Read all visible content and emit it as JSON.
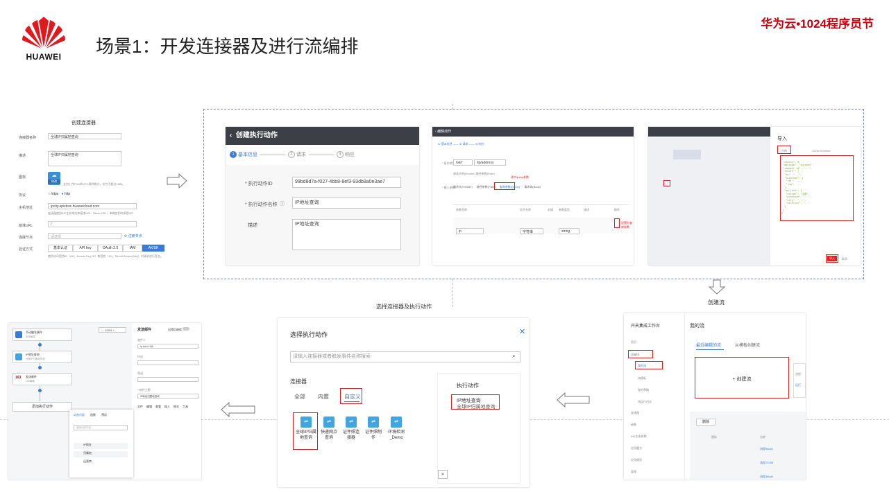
{
  "header": {
    "brand_logo_text": "HUAWEI",
    "title": "场景1：开发连接器及进行流编排",
    "event": "华为云•1024程序员节"
  },
  "connector_form": {
    "title": "创建连接器",
    "fields": [
      {
        "label": "连接器名称",
        "value": "全球IP归属地查询"
      },
      {
        "label": "描述",
        "value": "全球IP归属地查询"
      },
      {
        "label": "图标",
        "value": "修改"
      },
      {
        "label": "协议",
        "value": "https"
      },
      {
        "label": "主机地址",
        "value": "ipcity.apistore.huaweicloud.com"
      },
      {
        "label": "基准URL",
        "value": "/"
      },
      {
        "label": "连接节点",
        "value": "请选择"
      },
      {
        "label": "验证方式",
        "value": ""
      }
    ],
    "protocol_options": [
      "https",
      "http"
    ],
    "auth_tabs": [
      "基本认证",
      "API key",
      "OAuth 2.0",
      "IAM",
      "AK/SK"
    ],
    "auth_active": "AK/SK"
  },
  "action_panel": {
    "header": "创建执行动作",
    "steps": [
      "基本信息",
      "请求",
      "响应"
    ],
    "fields": [
      {
        "label": "* 执行动作ID",
        "value": "99bd8d7a-f027-4bb8-8ef3-93db8a0e3ae7"
      },
      {
        "label": "* 执行动作名称",
        "value": "IP地址查询"
      },
      {
        "label": "描述",
        "value": "IP地址查询"
      }
    ]
  },
  "request_panel": {
    "header": "编辑动作",
    "method": "GET",
    "path": "/ip/address",
    "tabs": [
      "请求头(Header)",
      "路径参数(Path)",
      "查询参数(Query)",
      "请求体(Body)"
    ],
    "note": "选中query参数",
    "red_label": "设置为查询参数",
    "row_value": "ip",
    "type_value": "字符串"
  },
  "import_panel": {
    "title": "导入",
    "tabs": [
      "示例",
      "JSON Schema"
    ],
    "button": "导入",
    "confirm": "确定",
    "cancel": "取消"
  },
  "create_flow_label": "创建流",
  "select_action_label": "选择连接器及执行动作",
  "flow_console": {
    "app": "开天集成工作台",
    "page": "我的流",
    "tabs": [
      "最近编辑的流",
      "从模板创建流"
    ],
    "new_flow": "+ 创建流",
    "nav": [
      "首页",
      "流编排",
      "我的流",
      "流模板",
      "我的草稿",
      "流运行日志",
      "连接器",
      "函数",
      "API生命周期",
      "应用魔方",
      "应用模型",
      "管理"
    ],
    "table_headers": [
      "图标",
      "名称"
    ],
    "delete": "删除",
    "rows": [
      "流程98c82",
      "流程73785",
      "流程38bd4"
    ],
    "side_label_1": "流程",
    "side_label_2": "运行"
  },
  "select_dialog": {
    "title": "选择执行动作",
    "search_placeholder": "请输入连接器或者触发事件名称搜索",
    "section": "连接器",
    "tabs": [
      "全部",
      "内置",
      "自定义"
    ],
    "active_tab": "自定义",
    "connectors": [
      "全球IP归属地查询",
      "快递网点查询",
      "证件照连接器",
      "证件照制作",
      "环境检测_Demo"
    ],
    "action_title": "执行动作",
    "action_item_1": "IP地址查询",
    "action_item_2": "全球IP归属地查询"
  },
  "flow_editor": {
    "zoom": "100%",
    "nodes": [
      {
        "title": "手动触发事件",
        "sub": "手动触发"
      },
      {
        "title": "IP地址查询",
        "sub": "全球IP归属地查询"
      },
      {
        "title": "发送邮件",
        "sub": "163邮箱"
      }
    ],
    "add_button": "添加执行动作",
    "panel_title": "发送邮件",
    "toggle_label": "出错后继续",
    "email_value": "ip.qhm.c1@...",
    "fields": [
      "收件人",
      "抄送",
      "密送",
      "* 邮件主题"
    ],
    "subject": "IP地址归属地查询",
    "editor_tabs": [
      "文件",
      "编辑",
      "查看",
      "插入",
      "格式",
      "工具"
    ],
    "popup_tabs": [
      "动态内容",
      "函数",
      "预设"
    ],
    "popup_search": "搜索动态内容",
    "popup_items": [
      "IP地址",
      "归属地",
      "运营商"
    ],
    "mail_label_163": "163"
  }
}
